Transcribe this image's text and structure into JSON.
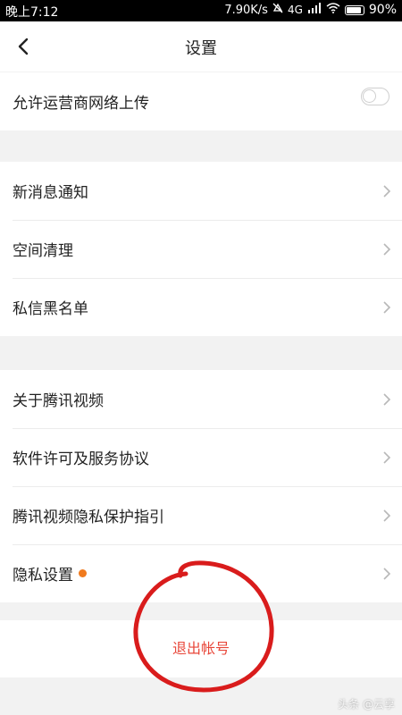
{
  "status_bar": {
    "time": "晚上7:12",
    "speed": "7.90K/s",
    "network": "4G",
    "battery": "90%",
    "battery_level": 0.9
  },
  "nav": {
    "title": "设置",
    "back_icon": "chevron-left-icon"
  },
  "upload_setting": {
    "label": "允许运营商网络上传",
    "enabled": false
  },
  "group_notifications": [
    {
      "label": "新消息通知"
    },
    {
      "label": "空间清理"
    },
    {
      "label": "私信黑名单"
    }
  ],
  "group_about": [
    {
      "label": "关于腾讯视频"
    },
    {
      "label": "软件许可及服务协议"
    },
    {
      "label": "腾讯视频隐私保护指引"
    },
    {
      "label": "隐私设置",
      "badge_dot": true
    }
  ],
  "logout": {
    "label": "退出帐号"
  },
  "watermark": "头条 @云享",
  "colors": {
    "accent_red": "#e8473a",
    "badge_orange": "#f07a1e",
    "annotation_red": "#d91c1c"
  }
}
